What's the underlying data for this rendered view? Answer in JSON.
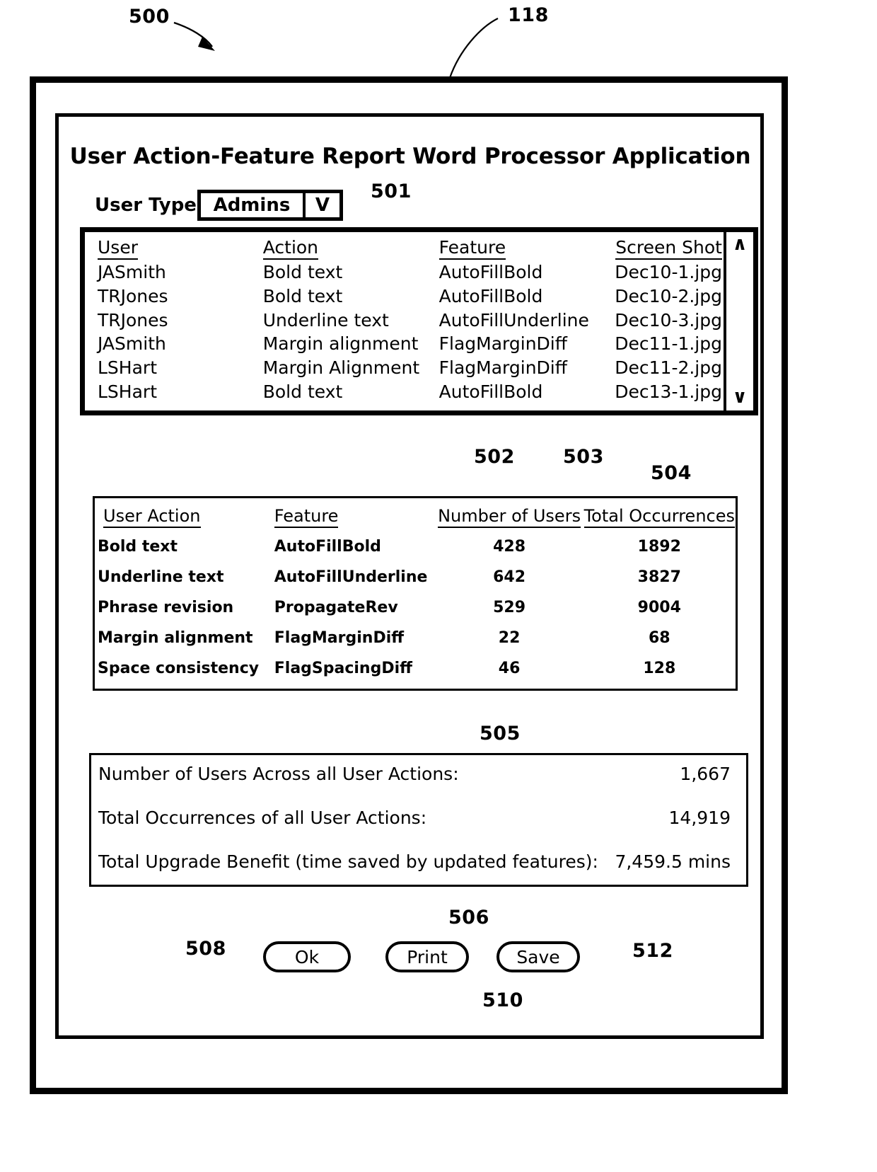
{
  "figure": {
    "refs": [
      {
        "id": "ref-500",
        "label": "500"
      },
      {
        "id": "ref-118",
        "label": "118"
      },
      {
        "id": "ref-501",
        "label": "501"
      },
      {
        "id": "ref-502",
        "label": "502"
      },
      {
        "id": "ref-503",
        "label": "503"
      },
      {
        "id": "ref-504",
        "label": "504"
      },
      {
        "id": "ref-505",
        "label": "505"
      },
      {
        "id": "ref-506",
        "label": "506"
      },
      {
        "id": "ref-508",
        "label": "508"
      },
      {
        "id": "ref-510",
        "label": "510"
      },
      {
        "id": "ref-512",
        "label": "512"
      }
    ]
  },
  "app": {
    "title": "User Action-Feature Report Word Processor Application"
  },
  "user_type": {
    "label": "User Type",
    "selected": "Admins",
    "caret": "V"
  },
  "detail_table": {
    "headers": [
      "User",
      "Action",
      "Feature",
      "Screen Shot"
    ],
    "rows": [
      {
        "user": "JASmith",
        "action": "Bold text",
        "feature": "AutoFillBold",
        "screenshot": "Dec10-1.jpg"
      },
      {
        "user": "TRJones",
        "action": "Bold text",
        "feature": "AutoFillBold",
        "screenshot": "Dec10-2.jpg"
      },
      {
        "user": "TRJones",
        "action": "Underline text",
        "feature": "AutoFillUnderline",
        "screenshot": "Dec10-3.jpg"
      },
      {
        "user": "JASmith",
        "action": "Margin alignment",
        "feature": "FlagMarginDiff",
        "screenshot": "Dec11-1.jpg"
      },
      {
        "user": "LSHart",
        "action": "Margin Alignment",
        "feature": "FlagMarginDiff",
        "screenshot": "Dec11-2.jpg"
      },
      {
        "user": "LSHart",
        "action": "Bold text",
        "feature": "AutoFillBold",
        "screenshot": "Dec13-1.jpg"
      }
    ],
    "scroll_up": "∧",
    "scroll_down": "∨"
  },
  "aggregate_table": {
    "headers": [
      "User Action",
      "Feature",
      "Number of Users",
      "Total Occurrences"
    ],
    "rows": [
      {
        "action": "Bold text",
        "feature": "AutoFillBold",
        "users": "428",
        "occurrences": "1892"
      },
      {
        "action": "Underline text",
        "feature": "AutoFillUnderline",
        "users": "642",
        "occurrences": "3827"
      },
      {
        "action": "Phrase revision",
        "feature": "PropagateRev",
        "users": "529",
        "occurrences": "9004"
      },
      {
        "action": "Margin alignment",
        "feature": "FlagMarginDiff",
        "users": "22",
        "occurrences": "68"
      },
      {
        "action": "Space consistency",
        "feature": "FlagSpacingDiff",
        "users": "46",
        "occurrences": "128"
      }
    ]
  },
  "totals": {
    "rows": [
      {
        "label": "Number of Users Across all User Actions:",
        "value": "1,667"
      },
      {
        "label": "Total Occurrences of all User Actions:",
        "value": "14,919"
      },
      {
        "label": "Total Upgrade Benefit (time saved by updated features):",
        "value": "7,459.5 mins"
      }
    ]
  },
  "buttons": {
    "ok": "Ok",
    "print": "Print",
    "save": "Save"
  }
}
